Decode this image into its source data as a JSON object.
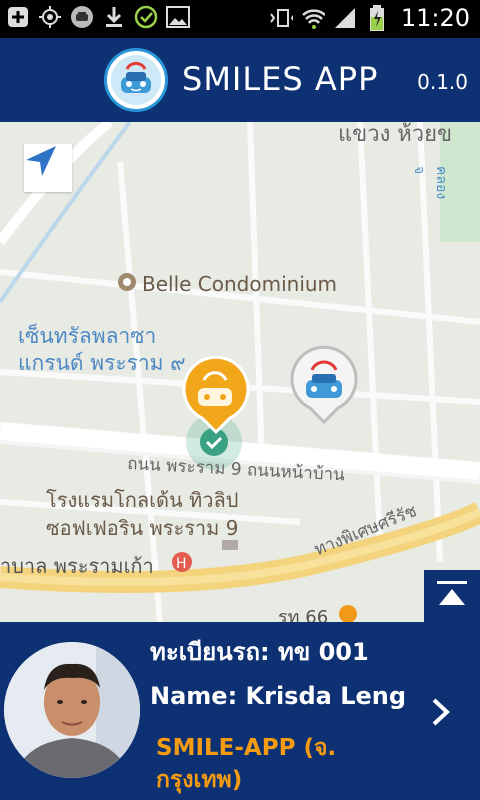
{
  "status_bar": {
    "time": "11:20",
    "icons_left": [
      "add-icon",
      "gps-icon",
      "car-icon",
      "download-icon",
      "check-icon",
      "image-icon"
    ],
    "icons_right": [
      "vibrate-icon",
      "wifi-icon",
      "signal-icon",
      "battery-icon"
    ]
  },
  "app_bar": {
    "title": "SMILES APP",
    "version": "0.1.0"
  },
  "map": {
    "labels": {
      "condominium": "Belle Condominium",
      "plaza_line1": "เซ็นทรัลพลาซา",
      "plaza_line2": "แกรนด์ พระราม ๙",
      "road_rama9": "ถนน พระราม 9 ถนนหน้าบ้าน",
      "hotel_line1": "โรงแรมโกลเด้น ทิวลิป",
      "hotel_line2": "ซอฟเฟอริน พระราม 9",
      "hospital": "าบาล พระรามเก้า",
      "expressway": "ทางพิเศษศรีรัช",
      "district": "แขวง ห้วยข",
      "road_right": "คลองจ",
      "road_66": "รท 66"
    },
    "colors": {
      "ground": "#e8eae4",
      "road": "#ffffff",
      "major_road": "#f3d37c",
      "pin_selected": "#f2a71b",
      "pin_other": "#f4f4f4"
    }
  },
  "driver": {
    "plate": "ทะเบียนรถ: ทข 001",
    "name": "Name: Krisda Leng",
    "company": "SMILE-APP (จ. กรุงเทพ)"
  }
}
